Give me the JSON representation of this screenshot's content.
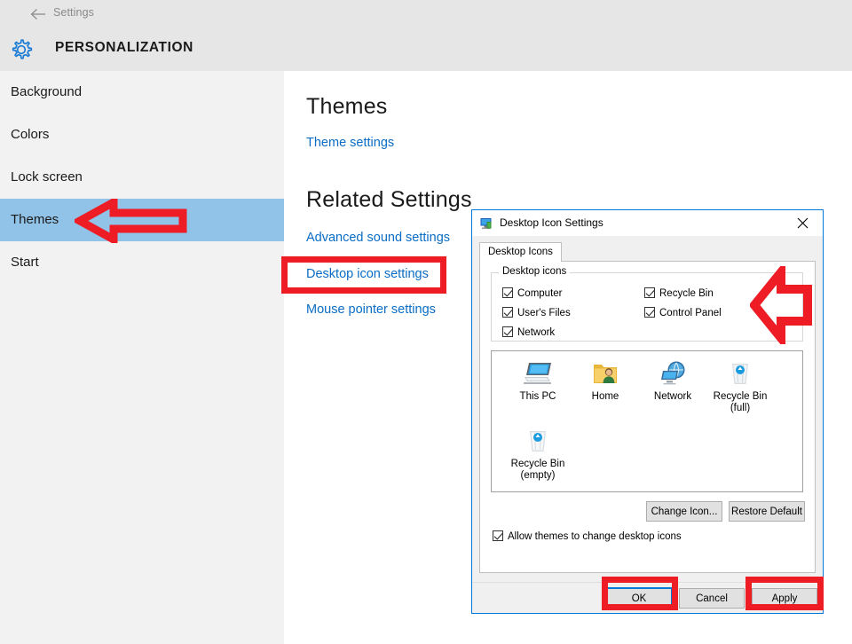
{
  "app": {
    "back_icon": "back-arrow-icon",
    "titlebar_label": "Settings",
    "gear_icon": "gear-icon",
    "header_title": "PERSONALIZATION",
    "accent_blue": "#0a6cc4",
    "selection_blue": "#91c3e8",
    "annotation_red": "#ee1c24"
  },
  "sidebar": {
    "items": [
      {
        "label": "Background",
        "selected": false
      },
      {
        "label": "Colors",
        "selected": false
      },
      {
        "label": "Lock screen",
        "selected": false
      },
      {
        "label": "Themes",
        "selected": true
      },
      {
        "label": "Start",
        "selected": false
      }
    ]
  },
  "main": {
    "page_title": "Themes",
    "theme_settings_link": "Theme settings",
    "related_title": "Related Settings",
    "related_links": [
      "Advanced sound settings",
      "Desktop icon settings",
      "Mouse pointer settings"
    ]
  },
  "dialog": {
    "window_icon": "desktop-icon-settings-icon",
    "title": "Desktop Icon Settings",
    "close_icon": "close-icon",
    "tab_label": "Desktop Icons",
    "group_legend": "Desktop icons",
    "checkboxes": [
      {
        "label": "Computer",
        "checked": true
      },
      {
        "label": "User's Files",
        "checked": true
      },
      {
        "label": "Network",
        "checked": true
      },
      {
        "label": "Recycle Bin",
        "checked": true
      },
      {
        "label": "Control Panel",
        "checked": true
      }
    ],
    "preview_icons": [
      {
        "label": "This PC",
        "icon": "this-pc-icon"
      },
      {
        "label": "Home",
        "icon": "home-folder-icon"
      },
      {
        "label": "Network",
        "icon": "network-icon"
      },
      {
        "label": "Recycle Bin\n(full)",
        "icon": "recycle-bin-full-icon"
      },
      {
        "label": "Recycle Bin\n(empty)",
        "icon": "recycle-bin-empty-icon"
      }
    ],
    "change_icon_button": "Change Icon...",
    "restore_default_button": "Restore Default",
    "allow_themes_checkbox": {
      "label": "Allow themes to change desktop icons",
      "checked": true
    },
    "ok_button": "OK",
    "cancel_button": "Cancel",
    "apply_button": "Apply"
  },
  "annotations": {
    "arrow_sidebar": "red-left-arrow-icon",
    "arrow_dialog": "red-left-arrow-icon",
    "box_desktop_icon_settings": "red-highlight-box",
    "box_ok": "red-highlight-box",
    "box_apply": "red-highlight-box"
  }
}
